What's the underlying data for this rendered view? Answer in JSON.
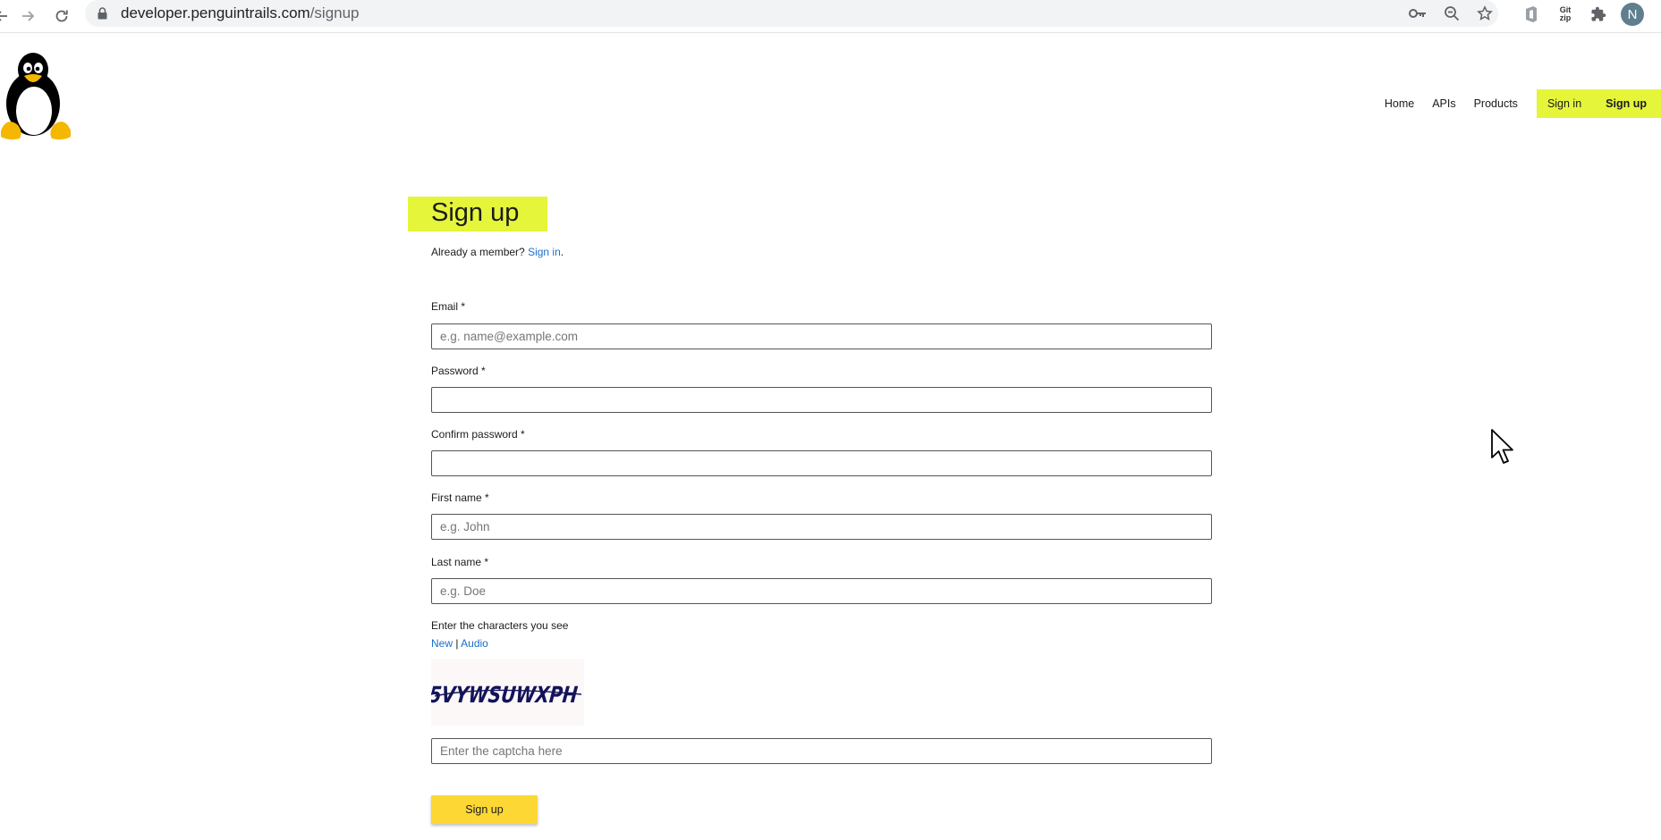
{
  "browser": {
    "url_domain": "developer.penguintrails.com",
    "url_path": "/signup",
    "profile_initial": "N",
    "gitzip_line1": "Git",
    "gitzip_line2": "zip"
  },
  "nav": {
    "items": [
      "Home",
      "APIs",
      "Products"
    ],
    "signin": "Sign in",
    "signup": "Sign up"
  },
  "form": {
    "title": "Sign up",
    "already_member": "Already a member?",
    "signin_link": "Sign in",
    "signin_suffix": ".",
    "email_label": "Email *",
    "email_placeholder": "e.g. name@example.com",
    "password_label": "Password *",
    "confirm_label": "Confirm password *",
    "firstname_label": "First name *",
    "firstname_placeholder": "e.g. John",
    "lastname_label": "Last name *",
    "lastname_placeholder": "e.g. Doe",
    "captcha_label": "Enter the characters you see",
    "captcha_new": "New",
    "captcha_sep": "|",
    "captcha_audio": "Audio",
    "captcha_text": "5VYWSUWXPH",
    "captcha_placeholder": "Enter the captcha here",
    "submit": "Sign up"
  },
  "colors": {
    "highlight": "#e5f53a",
    "button": "#fdd835",
    "link": "#1a6fc9"
  }
}
